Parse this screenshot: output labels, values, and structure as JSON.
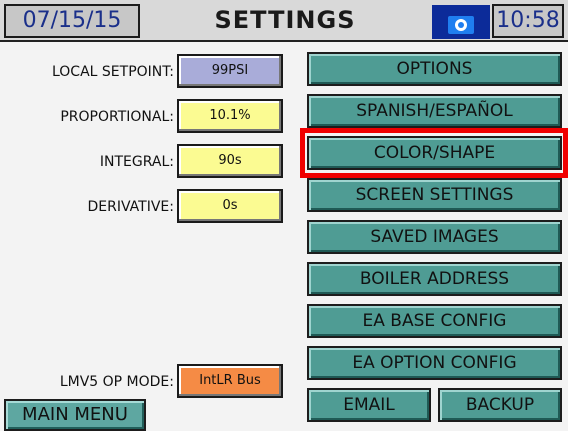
{
  "header": {
    "date": "07/15/15",
    "title": "SETTINGS",
    "time": "10:58"
  },
  "settings": {
    "local_setpoint": {
      "label": "LOCAL SETPOINT:",
      "value": "99PSI"
    },
    "proportional": {
      "label": "PROPORTIONAL:",
      "value": "10.1%"
    },
    "integral": {
      "label": "INTEGRAL:",
      "value": "90s"
    },
    "derivative": {
      "label": "DERIVATIVE:",
      "value": "0s"
    },
    "lmv5_op_mode": {
      "label": "LMV5 OP MODE:",
      "value": "IntLR Bus"
    }
  },
  "menu": {
    "options": "OPTIONS",
    "language": "SPANISH/ESPAÑOL",
    "color_shape": "COLOR/SHAPE",
    "screen_settings": "SCREEN SETTINGS",
    "saved_images": "SAVED IMAGES",
    "boiler_address": "BOILER ADDRESS",
    "ea_base_config": "EA BASE CONFIG",
    "ea_option_config": "EA OPTION CONFIG",
    "email": "EMAIL",
    "backup": "BACKUP"
  },
  "footer": {
    "main_menu": "MAIN MENU"
  },
  "colors": {
    "teal_button": "#4f9c94",
    "yellow_field": "#fbfb92",
    "blue_field": "#a9acd9",
    "orange_field": "#f58b45",
    "camera_bg": "#0c2b99",
    "highlight": "#f00000"
  },
  "icons": {
    "camera": "camera-icon"
  }
}
